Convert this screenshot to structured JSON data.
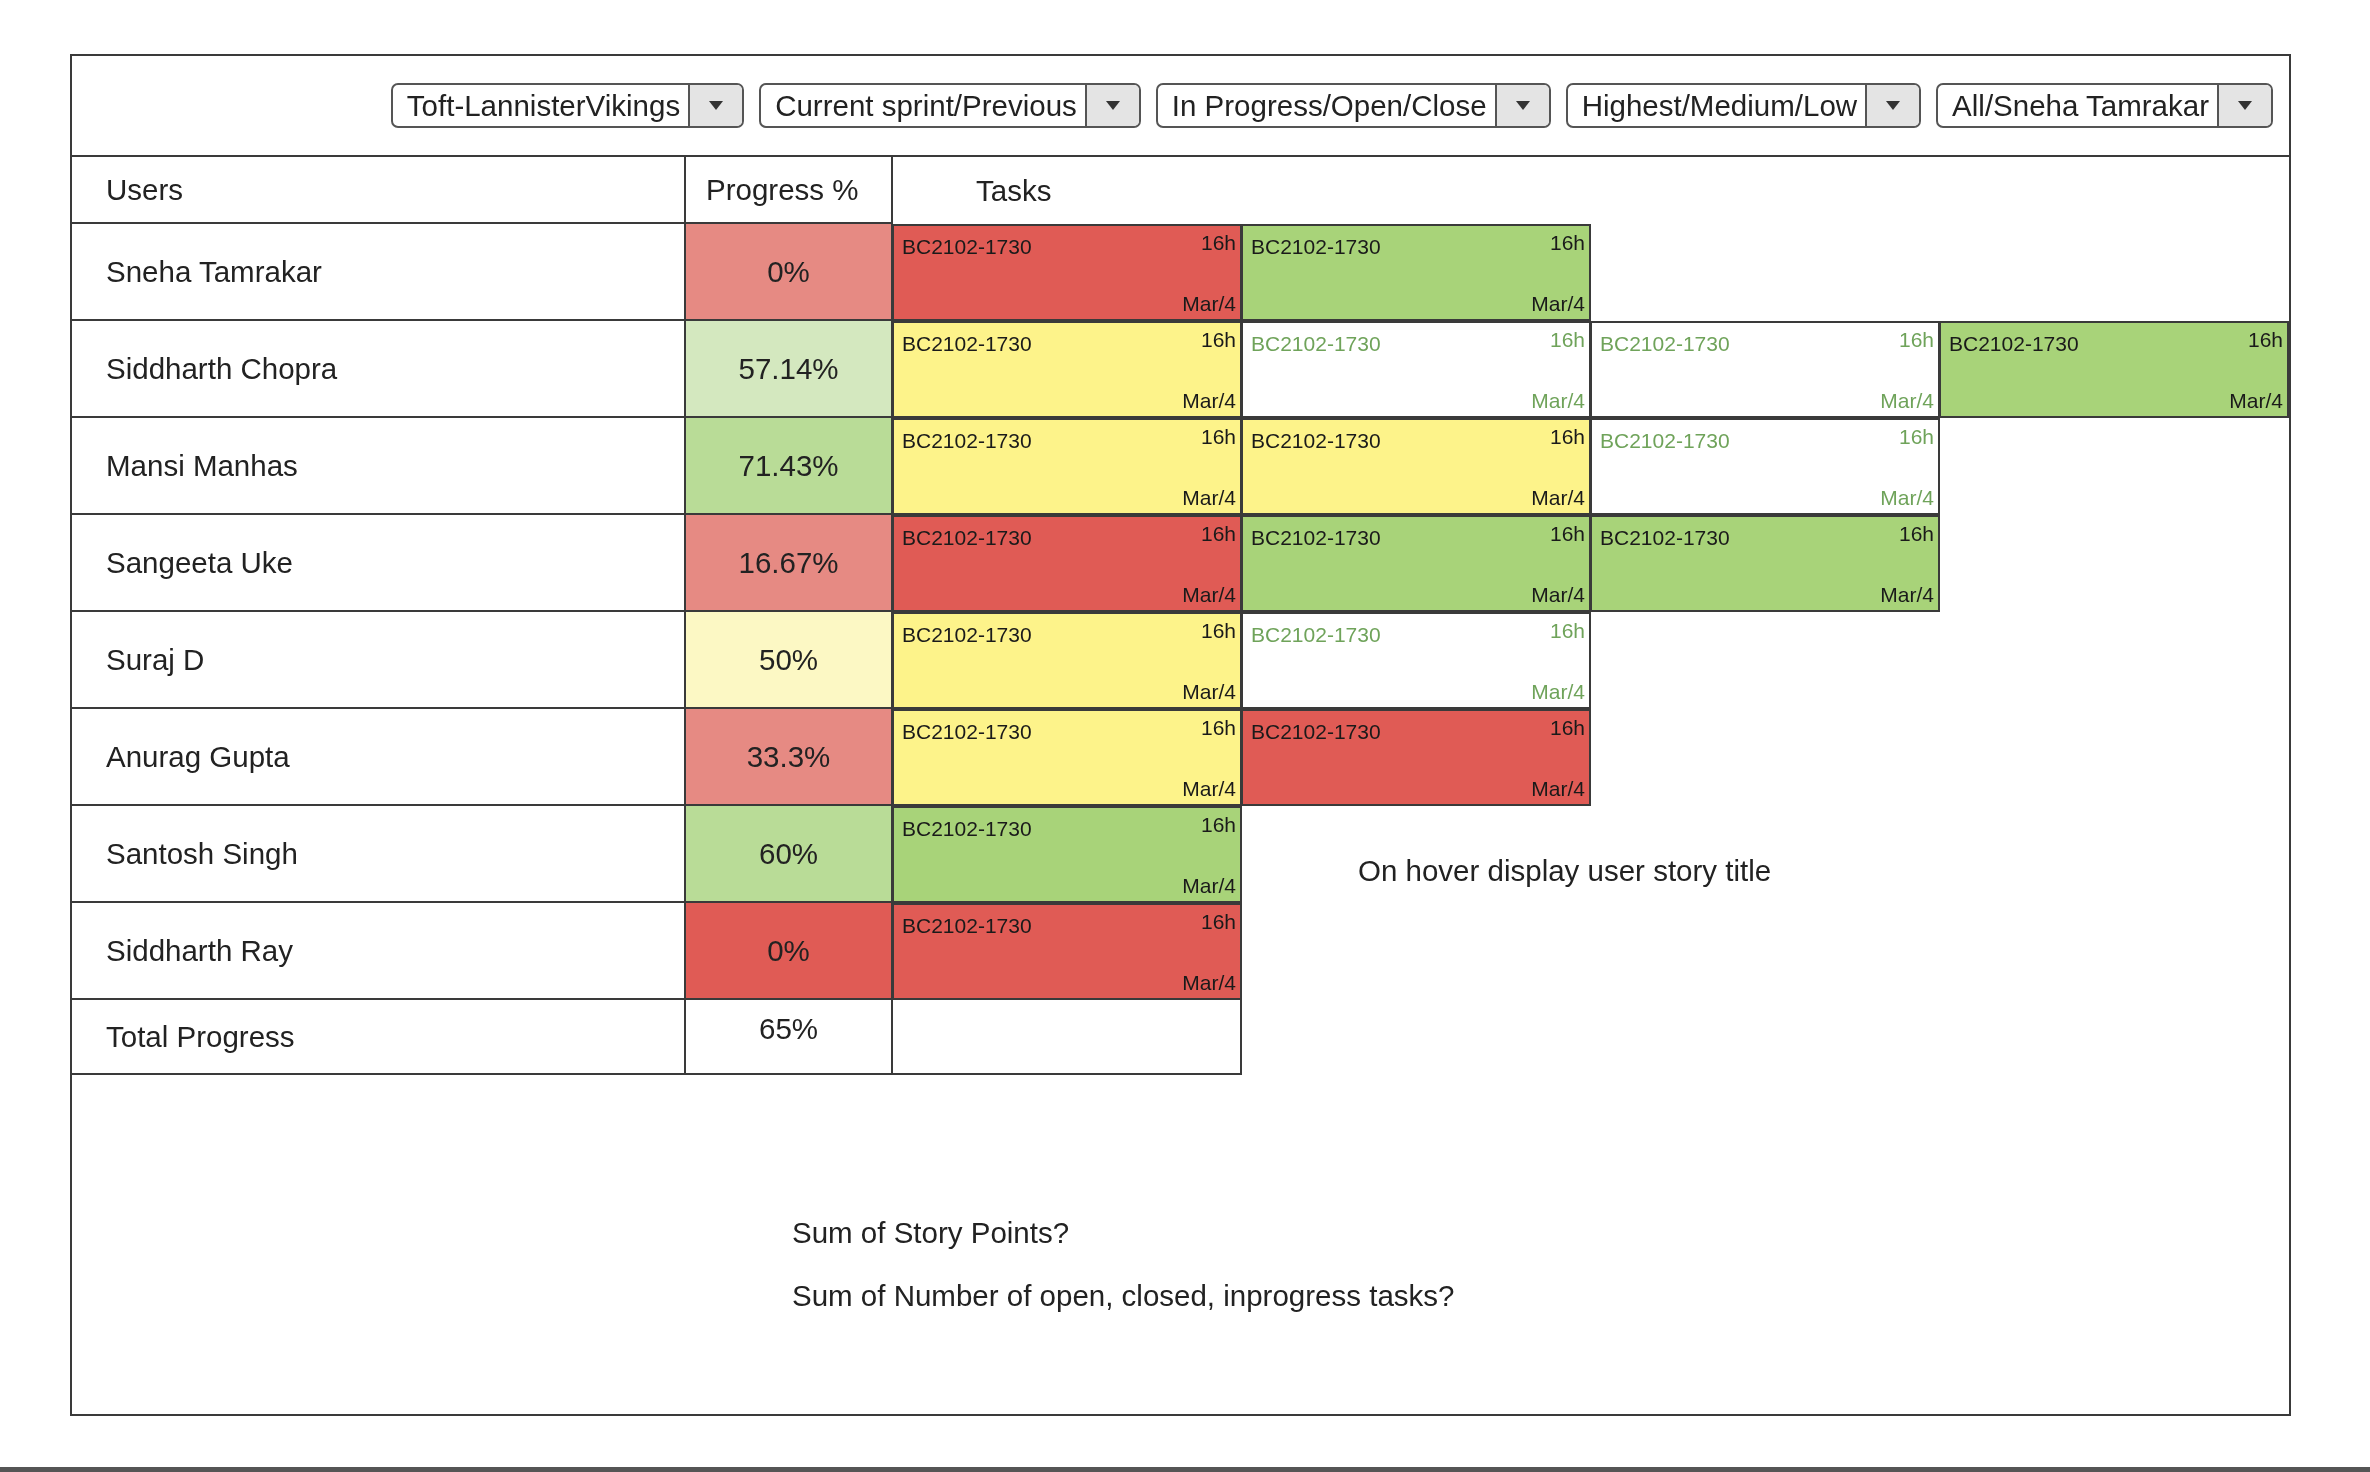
{
  "filters": [
    {
      "value": "Toft-LannisterVikings"
    },
    {
      "value": "Current sprint/Previous"
    },
    {
      "value": "In Progress/Open/Close"
    },
    {
      "value": "Highest/Medium/Low"
    },
    {
      "value": "All/Sneha Tamrakar"
    }
  ],
  "table": {
    "columns": [
      "Users",
      "Progress %",
      "Tasks"
    ],
    "rows": [
      {
        "name": "Sneha Tamrakar",
        "progress": "0%",
        "color": "#e68a83",
        "tasks": [
          {
            "kind": "filled",
            "color": "#e05b55",
            "ticket": "BC2102-1730",
            "hours": "16h",
            "date": "Mar/4"
          },
          {
            "kind": "filled",
            "color": "#a8d379",
            "ticket": "BC2102-1730",
            "hours": "16h",
            "date": "Mar/4"
          }
        ]
      },
      {
        "name": "Siddharth Chopra",
        "progress": "57.14%",
        "color": "#d4e8bf",
        "tasks": [
          {
            "kind": "filled",
            "color": "#fdf38a",
            "ticket": "BC2102-1730",
            "hours": "16h",
            "date": "Mar/4"
          },
          {
            "kind": "outlined",
            "color": "#6fa35a",
            "ticket": "BC2102-1730",
            "hours": "16h",
            "date": "Mar/4"
          },
          {
            "kind": "outlined",
            "color": "#6fa35a",
            "ticket": "BC2102-1730",
            "hours": "16h",
            "date": "Mar/4"
          },
          {
            "kind": "filled",
            "color": "#a8d379",
            "ticket": "BC2102-1730",
            "hours": "16h",
            "date": "Mar/4"
          }
        ]
      },
      {
        "name": "Mansi Manhas",
        "progress": "71.43%",
        "color": "#b9dc97",
        "tasks": [
          {
            "kind": "filled",
            "color": "#fdf38a",
            "ticket": "BC2102-1730",
            "hours": "16h",
            "date": "Mar/4"
          },
          {
            "kind": "filled",
            "color": "#fdf38a",
            "ticket": "BC2102-1730",
            "hours": "16h",
            "date": "Mar/4"
          },
          {
            "kind": "outlined",
            "color": "#6fa35a",
            "ticket": "BC2102-1730",
            "hours": "16h",
            "date": "Mar/4"
          }
        ]
      },
      {
        "name": "Sangeeta Uke",
        "progress": "16.67%",
        "color": "#e68a83",
        "tasks": [
          {
            "kind": "filled",
            "color": "#e05b55",
            "ticket": "BC2102-1730",
            "hours": "16h",
            "date": "Mar/4"
          },
          {
            "kind": "filled",
            "color": "#a8d379",
            "ticket": "BC2102-1730",
            "hours": "16h",
            "date": "Mar/4"
          },
          {
            "kind": "filled",
            "color": "#a8d379",
            "ticket": "BC2102-1730",
            "hours": "16h",
            "date": "Mar/4"
          }
        ]
      },
      {
        "name": "Suraj D",
        "progress": "50%",
        "color": "#fcf8c4",
        "tasks": [
          {
            "kind": "filled",
            "color": "#fdf38a",
            "ticket": "BC2102-1730",
            "hours": "16h",
            "date": "Mar/4"
          },
          {
            "kind": "outlined",
            "color": "#6fa35a",
            "ticket": "BC2102-1730",
            "hours": "16h",
            "date": "Mar/4"
          }
        ]
      },
      {
        "name": "Anurag Gupta",
        "progress": "33.3%",
        "color": "#e68a83",
        "tasks": [
          {
            "kind": "filled",
            "color": "#fdf38a",
            "ticket": "BC2102-1730",
            "hours": "16h",
            "date": "Mar/4"
          },
          {
            "kind": "filled",
            "color": "#e05b55",
            "ticket": "BC2102-1730",
            "hours": "16h",
            "date": "Mar/4"
          }
        ]
      },
      {
        "name": "Santosh Singh",
        "progress": "60%",
        "color": "#b9dc97",
        "tasks": [
          {
            "kind": "filled",
            "color": "#a8d379",
            "ticket": "BC2102-1730",
            "hours": "16h",
            "date": "Mar/4"
          }
        ]
      },
      {
        "name": "Siddharth Ray",
        "progress": "0%",
        "color": "#e05b55",
        "tasks": [
          {
            "kind": "filled",
            "color": "#e05b55",
            "ticket": "BC2102-1730",
            "hours": "16h",
            "date": "Mar/4"
          }
        ]
      }
    ],
    "total": {
      "label": "Total Progress",
      "progress": "65%",
      "color": "#ffffff"
    }
  },
  "hover_note": "On hover display user story title",
  "notes": [
    "Sum of Story Points?",
    "Sum of Number of open, closed, inprogress tasks?"
  ]
}
